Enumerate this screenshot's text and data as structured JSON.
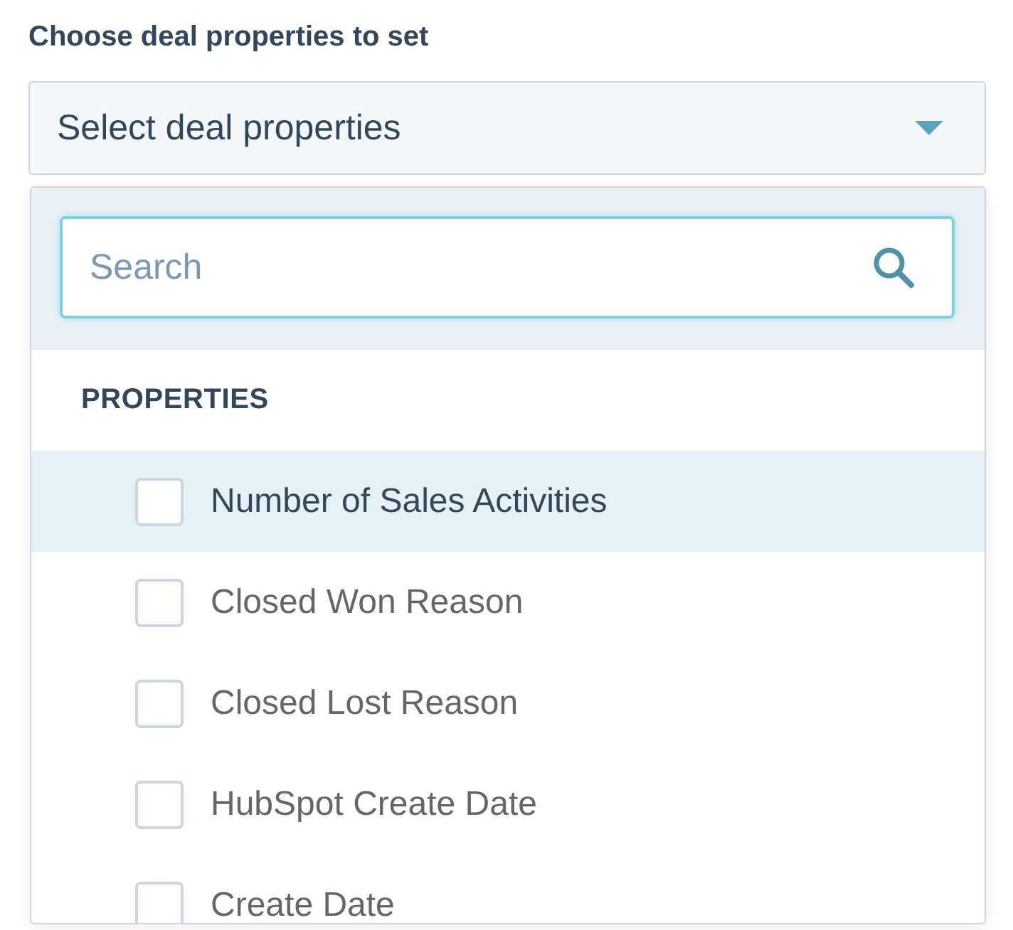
{
  "label": "Choose deal properties to set",
  "select": {
    "placeholder": "Select deal properties",
    "expanded": true
  },
  "search": {
    "placeholder": "Search"
  },
  "section": {
    "title": "PROPERTIES"
  },
  "options": [
    {
      "label": "Number of Sales Activities",
      "checked": false,
      "highlighted": true
    },
    {
      "label": "Closed Won Reason",
      "checked": false,
      "highlighted": false
    },
    {
      "label": "Closed Lost Reason",
      "checked": false,
      "highlighted": false
    },
    {
      "label": "HubSpot Create Date",
      "checked": false,
      "highlighted": false
    },
    {
      "label": "Create Date",
      "checked": false,
      "highlighted": false
    }
  ]
}
